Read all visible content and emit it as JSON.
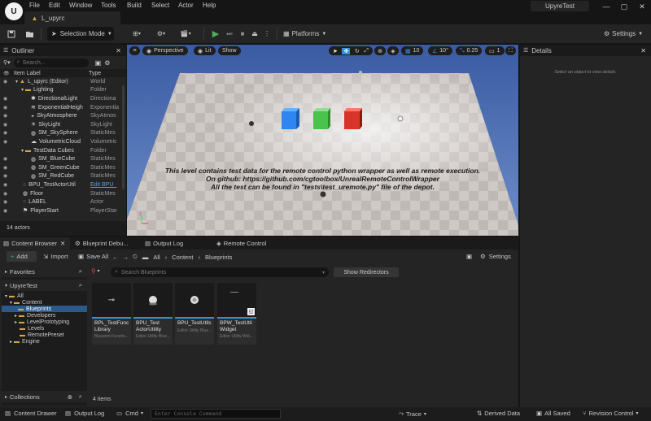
{
  "app": {
    "menu": [
      "File",
      "Edit",
      "Window",
      "Tools",
      "Build",
      "Select",
      "Actor",
      "Help"
    ],
    "level_tab": "L_upyrc",
    "project_name": "UpyreTest"
  },
  "toolbar": {
    "selection_mode": "Selection Mode",
    "platforms": "Platforms",
    "settings": "Settings"
  },
  "outliner": {
    "tab": "Outliner",
    "search_placeholder": "Search...",
    "col_label": "Item Label",
    "col_type": "Type",
    "rows": [
      {
        "name": "L_upyrc (Editor)",
        "type": "World"
      },
      {
        "name": "Lighting",
        "type": "Folder"
      },
      {
        "name": "DirectionalLight",
        "type": "Directiona"
      },
      {
        "name": "ExponentialHeigh",
        "type": "Exponentia"
      },
      {
        "name": "SkyAtmosphere",
        "type": "SkyAtmos"
      },
      {
        "name": "SkyLight",
        "type": "SkyLight"
      },
      {
        "name": "SM_SkySphere",
        "type": "StaticMes"
      },
      {
        "name": "VolumetricCloud",
        "type": "Volumetric"
      },
      {
        "name": "TestData Cubes",
        "type": "Folder"
      },
      {
        "name": "SM_BlueCube",
        "type": "StaticMes"
      },
      {
        "name": "SM_GreenCube",
        "type": "StaticMes"
      },
      {
        "name": "SM_RedCube",
        "type": "StaticMes"
      },
      {
        "name": "BPU_TestActorUtil",
        "type": "Edit BPU_"
      },
      {
        "name": "Floor",
        "type": "StaticMes"
      },
      {
        "name": "LABEL",
        "type": "Actor"
      },
      {
        "name": "PlayerStart",
        "type": "PlayerStar"
      }
    ],
    "count": "14 actors"
  },
  "viewport": {
    "perspective": "Perspective",
    "lit": "Lit",
    "show": "Show",
    "grid_snap": "10",
    "rot_snap": "10°",
    "scale_snap": "0.25",
    "camera_speed": "1",
    "text_lines": [
      "This level contains test data for the remote control python wrapper as well as remote execution.",
      "On github: https://github.com/cgtoolbox/UnrealRemoteControlWrapper",
      "All the test can be found in \"tests\\test_uremote.py\" file of the depot."
    ]
  },
  "details": {
    "tab": "Details",
    "empty": "Select an object to view details."
  },
  "bottom_tabs": [
    "Content Browser",
    "Blueprint Debu...",
    "Output Log",
    "Remote Control"
  ],
  "content_browser": {
    "add": "Add",
    "import": "Import",
    "save_all": "Save All",
    "path": [
      "All",
      "Content",
      "Blueprints"
    ],
    "settings": "Settings",
    "favorites": "Favorites",
    "project": "UpyreTest",
    "collections": "Collections",
    "search_placeholder": "Search Blueprints",
    "show_redirectors": "Show Redirectors",
    "tree": [
      {
        "name": "All",
        "depth": 0,
        "arrow": "▾"
      },
      {
        "name": "Content",
        "depth": 1,
        "arrow": "▾"
      },
      {
        "name": "Blueprints",
        "depth": 2,
        "arrow": "",
        "selected": true
      },
      {
        "name": "Developers",
        "depth": 2,
        "arrow": "▸"
      },
      {
        "name": "LevelPrototyping",
        "depth": 2,
        "arrow": "▸"
      },
      {
        "name": "Levels",
        "depth": 2,
        "arrow": ""
      },
      {
        "name": "RemotePreset",
        "depth": 2,
        "arrow": ""
      },
      {
        "name": "Engine",
        "depth": 1,
        "arrow": "▸"
      }
    ],
    "assets": [
      {
        "name": "BPL_TestFunc Library",
        "type": "Blueprint Functio..."
      },
      {
        "name": "BPU_Test ActorUtility",
        "type": "Editor Utility Blue..."
      },
      {
        "name": "BPU_TestUtils",
        "type": "Editor Utility Blue..."
      },
      {
        "name": "BPW_TestUtil Widget",
        "type": "Editor Utility Wid..."
      }
    ],
    "item_count": "4 items"
  },
  "status": {
    "content_drawer": "Content Drawer",
    "output_log": "Output Log",
    "cmd": "Cmd",
    "console_placeholder": "Enter Console Command",
    "trace": "Trace",
    "derived_data": "Derived Data",
    "all_saved": "All Saved",
    "revision_control": "Revision Control"
  },
  "colors": {
    "viewport_sky": "#3c5fa8",
    "accent_blue": "#3a8de0",
    "play_green": "#4caf50",
    "folder": "#d4a548"
  }
}
